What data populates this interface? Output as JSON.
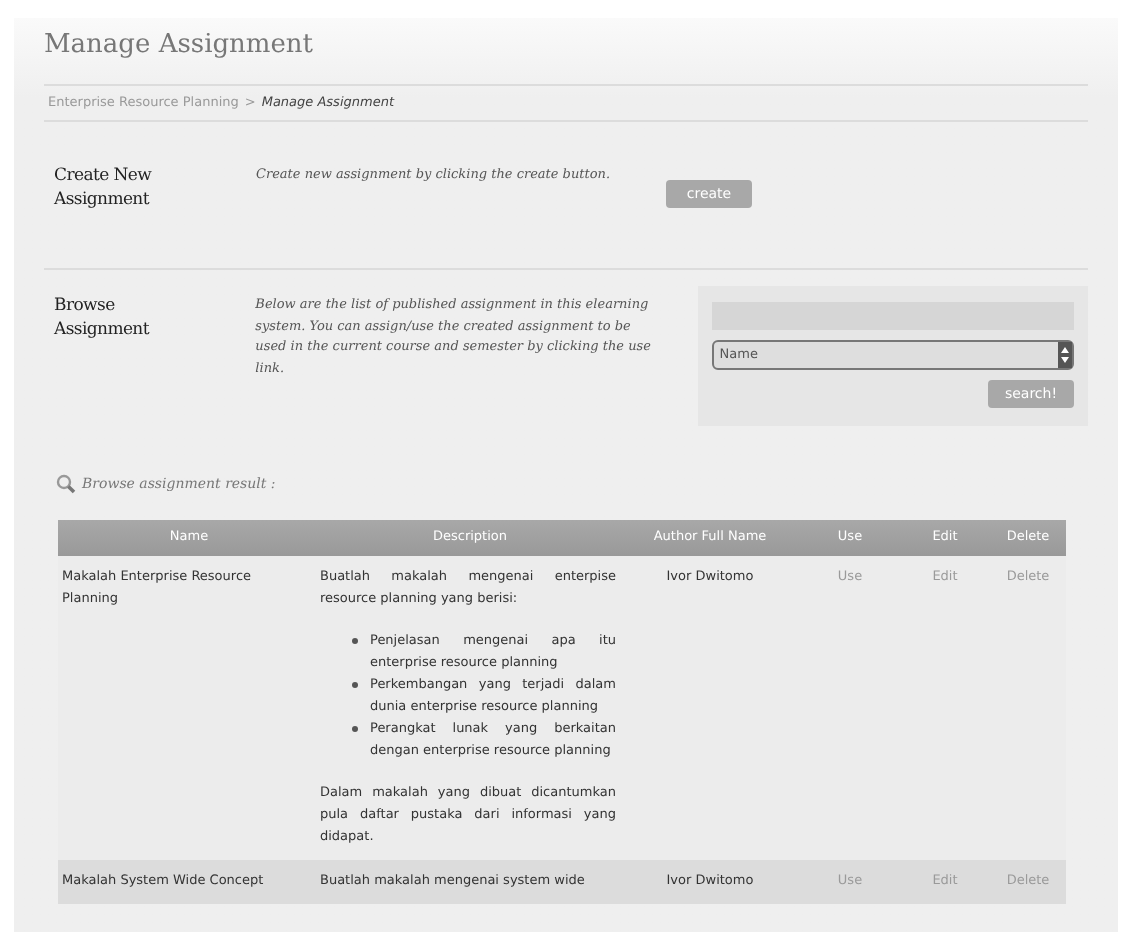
{
  "page": {
    "title": "Manage Assignment"
  },
  "breadcrumb": [
    {
      "label": "Enterprise Resource Planning",
      "current": false
    },
    {
      "label": "Manage Assignment",
      "current": true
    }
  ],
  "breadcrumb_separator": ">",
  "create_section": {
    "heading": "Create New Assignment",
    "description": "Create new assignment by clicking the create button.",
    "button": "create"
  },
  "browse_section": {
    "heading": "Browse Assignment",
    "description": "Below are the list of published assignment in this elearning system. You can assign/use the created assignment to be used in the current course and semester by clicking the use link.",
    "filter": {
      "value": "Name"
    },
    "button": "search!"
  },
  "result_label": "Browse assignment result :",
  "table": {
    "columns": [
      "Name",
      "Description",
      "Author Full Name",
      "Use",
      "Edit",
      "Delete"
    ],
    "rows": [
      {
        "name": "Makalah Enterprise Resource Planning",
        "description": [
          {
            "kind": "paragraph",
            "text": "Buatlah makalah mengenai enterpise resource planning yang berisi:"
          },
          {
            "kind": "list",
            "items": [
              "Penjelasan mengenai apa itu enterprise resource planning",
              "Perkembangan yang terjadi dalam dunia enterprise resource planning",
              "Perangkat lunak yang berkaitan dengan enterprise resource planning"
            ]
          },
          {
            "kind": "paragraph",
            "text": "Dalam makalah yang dibuat dicantumkan pula daftar pustaka dari informasi yang didapat."
          }
        ],
        "author": "Ivor Dwitomo",
        "actions": [
          {
            "label": "Use",
            "disabled": true
          },
          {
            "label": "Edit",
            "disabled": true
          },
          {
            "label": "Delete",
            "disabled": true
          }
        ]
      },
      {
        "name": "Makalah System Wide Concept",
        "description": [
          {
            "kind": "paragraph",
            "text": "Buatlah makalah mengenai system wide"
          }
        ],
        "author": "Ivor Dwitomo",
        "actions": [
          {
            "label": "Use",
            "disabled": true
          },
          {
            "label": "Edit",
            "disabled": true
          },
          {
            "label": "Delete",
            "disabled": true
          }
        ]
      }
    ]
  }
}
